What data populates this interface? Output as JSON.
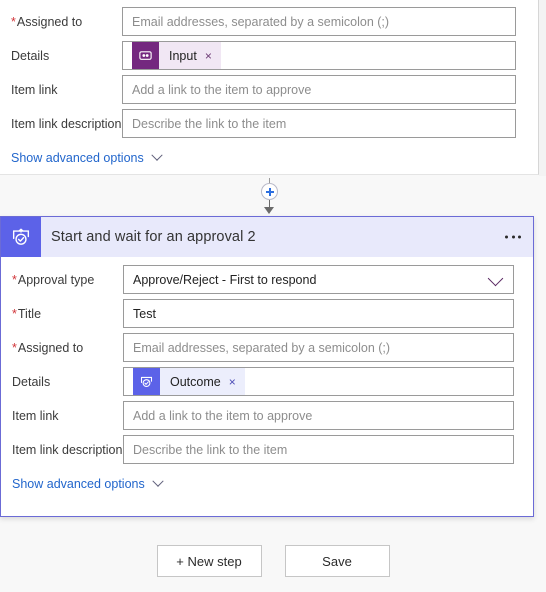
{
  "colors": {
    "accent_blue_violet": "#5C62E8",
    "header_band": "#E8E9FB",
    "selected_border": "#6B6BD6",
    "required_asterisk": "#D13438",
    "link_blue": "#2266CC",
    "chip_purple_tile": "#74287F",
    "chip_purple_bg": "#F1E7F4",
    "canvas_bg": "#F8F8F8"
  },
  "card_top": {
    "rows": [
      {
        "label": "Assigned to",
        "required": true,
        "type": "text",
        "placeholder": "Email addresses, separated by a semicolon (;)",
        "value": ""
      },
      {
        "label": "Details",
        "required": false,
        "type": "token",
        "token": {
          "text": "Input",
          "remove": "×",
          "icon": "compose-icon"
        }
      },
      {
        "label": "Item link",
        "required": false,
        "type": "text",
        "placeholder": "Add a link to the item to approve",
        "value": ""
      },
      {
        "label": "Item link description",
        "required": false,
        "type": "text",
        "placeholder": "Describe the link to the item",
        "value": ""
      }
    ],
    "advanced_options": {
      "label": "Show advanced options",
      "icon": "chevron-down-icon"
    }
  },
  "connector": {
    "add_step_icon": "plus-icon",
    "arrow_icon": "arrow-down-icon"
  },
  "card_selected": {
    "header": {
      "title": "Start and wait for an approval 2",
      "icon": "approval-icon",
      "menu_icon": "ellipsis-icon"
    },
    "rows": [
      {
        "label": "Approval type",
        "required": true,
        "type": "select",
        "value": "Approve/Reject - First to respond",
        "icon": "chevron-down-icon"
      },
      {
        "label": "Title",
        "required": true,
        "type": "text",
        "placeholder": "",
        "value": "Test"
      },
      {
        "label": "Assigned to",
        "required": true,
        "type": "text",
        "placeholder": "Email addresses, separated by a semicolon (;)",
        "value": ""
      },
      {
        "label": "Details",
        "required": false,
        "type": "token",
        "token": {
          "text": "Outcome",
          "remove": "×",
          "icon": "approval-token-icon"
        }
      },
      {
        "label": "Item link",
        "required": false,
        "type": "text",
        "placeholder": "Add a link to the item to approve",
        "value": ""
      },
      {
        "label": "Item link description",
        "required": false,
        "type": "text",
        "placeholder": "Describe the link to the item",
        "value": ""
      }
    ],
    "advanced_options": {
      "label": "Show advanced options",
      "icon": "chevron-down-icon"
    }
  },
  "footer": {
    "new_step_label": "+ New step",
    "save_label": "Save"
  }
}
